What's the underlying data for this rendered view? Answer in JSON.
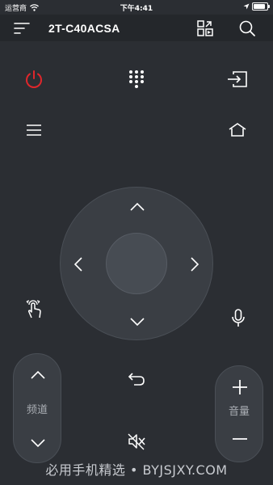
{
  "status_bar": {
    "carrier": "运营商",
    "time": "下午4:41",
    "battery_level": 0.9
  },
  "header": {
    "title": "2T-C40ACSA",
    "icons": [
      "menu-icon",
      "input-switch-icon",
      "search-icon"
    ]
  },
  "remote": {
    "channel_label": "频道",
    "volume_label": "音量",
    "icons": [
      "power-icon",
      "numpad-icon",
      "input-source-icon",
      "menu-list-icon",
      "home-icon",
      "touch-gesture-icon",
      "microphone-icon",
      "back-icon",
      "mute-icon"
    ],
    "colors": {
      "power": "#e0262b",
      "background": "#2b2e33"
    }
  },
  "watermark": "必用手机精选 • BYJSJXY.COM"
}
